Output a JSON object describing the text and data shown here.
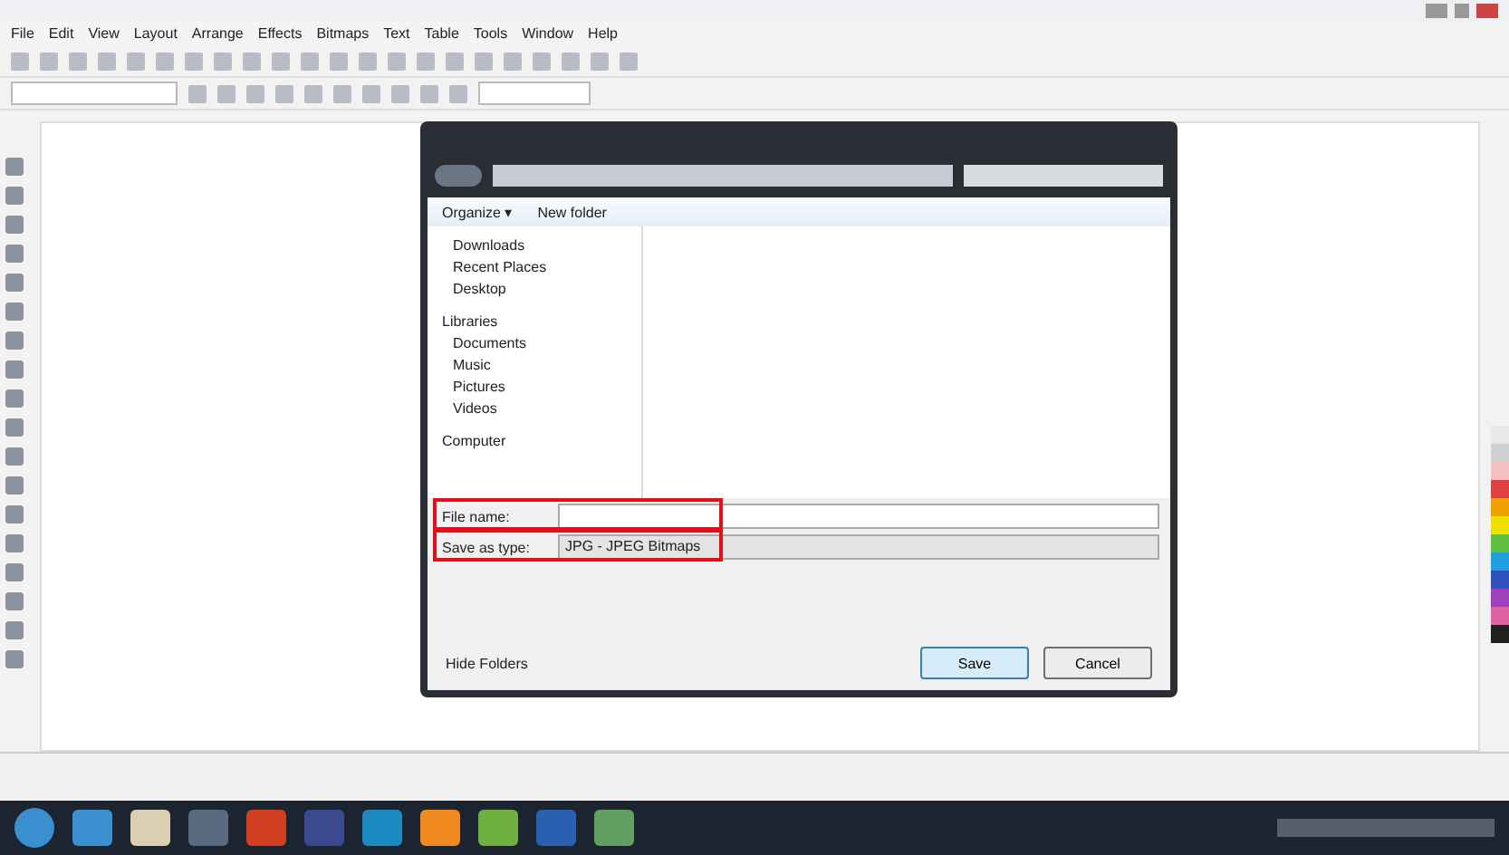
{
  "menu": [
    "File",
    "Edit",
    "View",
    "Layout",
    "Arrange",
    "Effects",
    "Bitmaps",
    "Text",
    "Table",
    "Tools",
    "Window",
    "Help"
  ],
  "dialog": {
    "toolbar": {
      "organize": "Organize ▾",
      "new_folder": "New folder"
    },
    "sidebar": {
      "favorites": [
        "Downloads",
        "Recent Places",
        "Desktop"
      ],
      "libraries": {
        "label": "Libraries",
        "items": [
          "Documents",
          "Music",
          "Pictures",
          "Videos"
        ]
      },
      "computer": "Computer"
    },
    "file_name": {
      "label": "File name:"
    },
    "save_as_type": {
      "label": "Save as type:",
      "value": "JPG - JPEG Bitmaps"
    },
    "hide_folders": "Hide Folders",
    "buttons": [
      {
        "label": "Save",
        "kind": "primary"
      },
      {
        "label": "Cancel",
        "kind": "secondary"
      }
    ]
  }
}
